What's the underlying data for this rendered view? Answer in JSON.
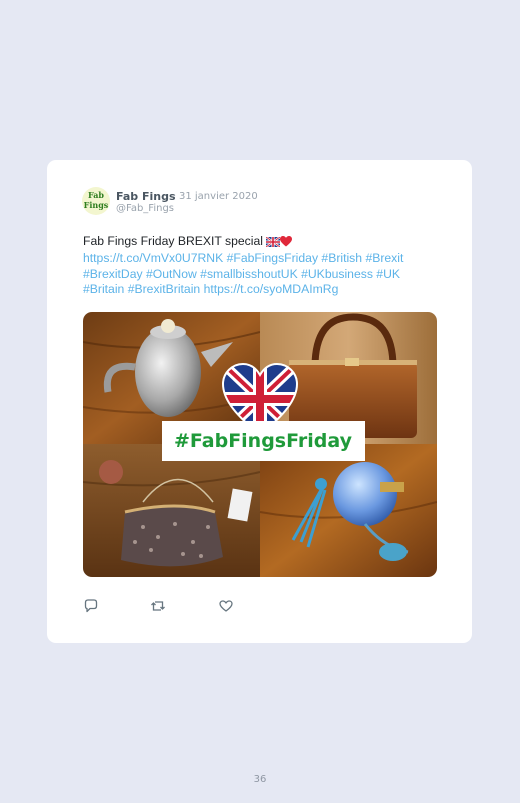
{
  "tweet": {
    "author": {
      "name": "Fab Fings",
      "handle": "@Fab_Fings",
      "avatar_logo_line1": "Fab",
      "avatar_logo_line2": "Fings"
    },
    "separator": "·",
    "date": "31 janvier 2020",
    "text_plain": "Fab Fings Friday BREXIT special ",
    "emoji": [
      "uk-flag-icon",
      "red-heart-icon"
    ],
    "text_line2_links": "https://t.co/VmVx0U7RNK #FabFingsFriday #British #Brexit",
    "text_line3_links": "#BrexitDay #OutNow #smallbisshoutUK #UKbusiness #UK",
    "text_line4_links": "#Britain #BrexitBritain https://t.co/syoMDAImRg",
    "media": {
      "overlay_hashtag": "#FabFingsFriday",
      "overlay_icon": "union-jack-heart-icon",
      "panels": [
        "silver-jug",
        "brown-handbag",
        "sequin-purse",
        "perfume-atomiser"
      ]
    },
    "actions": [
      "reply-icon",
      "retweet-icon",
      "like-icon"
    ]
  },
  "page": {
    "number": "36"
  },
  "colors": {
    "background": "#e5e8f3",
    "card": "#ffffff",
    "link": "#5cb3e8",
    "hashtag_green": "#1f9a3a"
  }
}
